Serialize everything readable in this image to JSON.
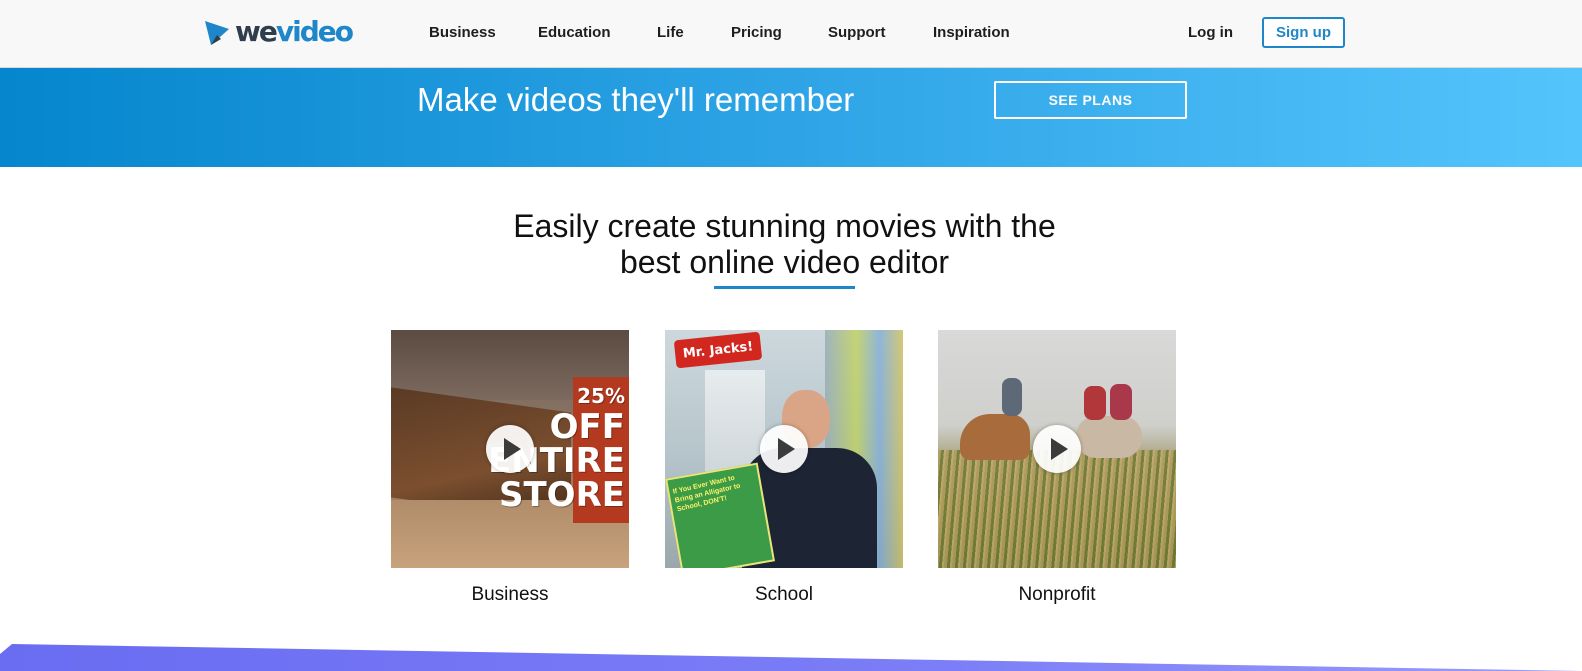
{
  "brand": {
    "we": "we",
    "video": "video",
    "accent": "#1f86c9",
    "dark": "#2e3e4c"
  },
  "nav": {
    "items": [
      {
        "label": "Business"
      },
      {
        "label": "Education"
      },
      {
        "label": "Life"
      },
      {
        "label": "Pricing"
      },
      {
        "label": "Support"
      },
      {
        "label": "Inspiration"
      }
    ],
    "login": "Log in",
    "signup": "Sign up"
  },
  "banner": {
    "title": "Make videos they'll remember",
    "cta": "SEE PLANS"
  },
  "headline": {
    "line1": "Easily create stunning movies with the",
    "line2": "best online video editor"
  },
  "cards": [
    {
      "label": "Business",
      "overlay": [
        "25%",
        "OFF",
        "ENTIRE",
        "STORE"
      ]
    },
    {
      "label": "School",
      "overlay": [
        "Mr. Jacks!"
      ],
      "book_title": "If You Ever Want to Bring an Alligator to School, DON'T!"
    },
    {
      "label": "Nonprofit"
    }
  ]
}
